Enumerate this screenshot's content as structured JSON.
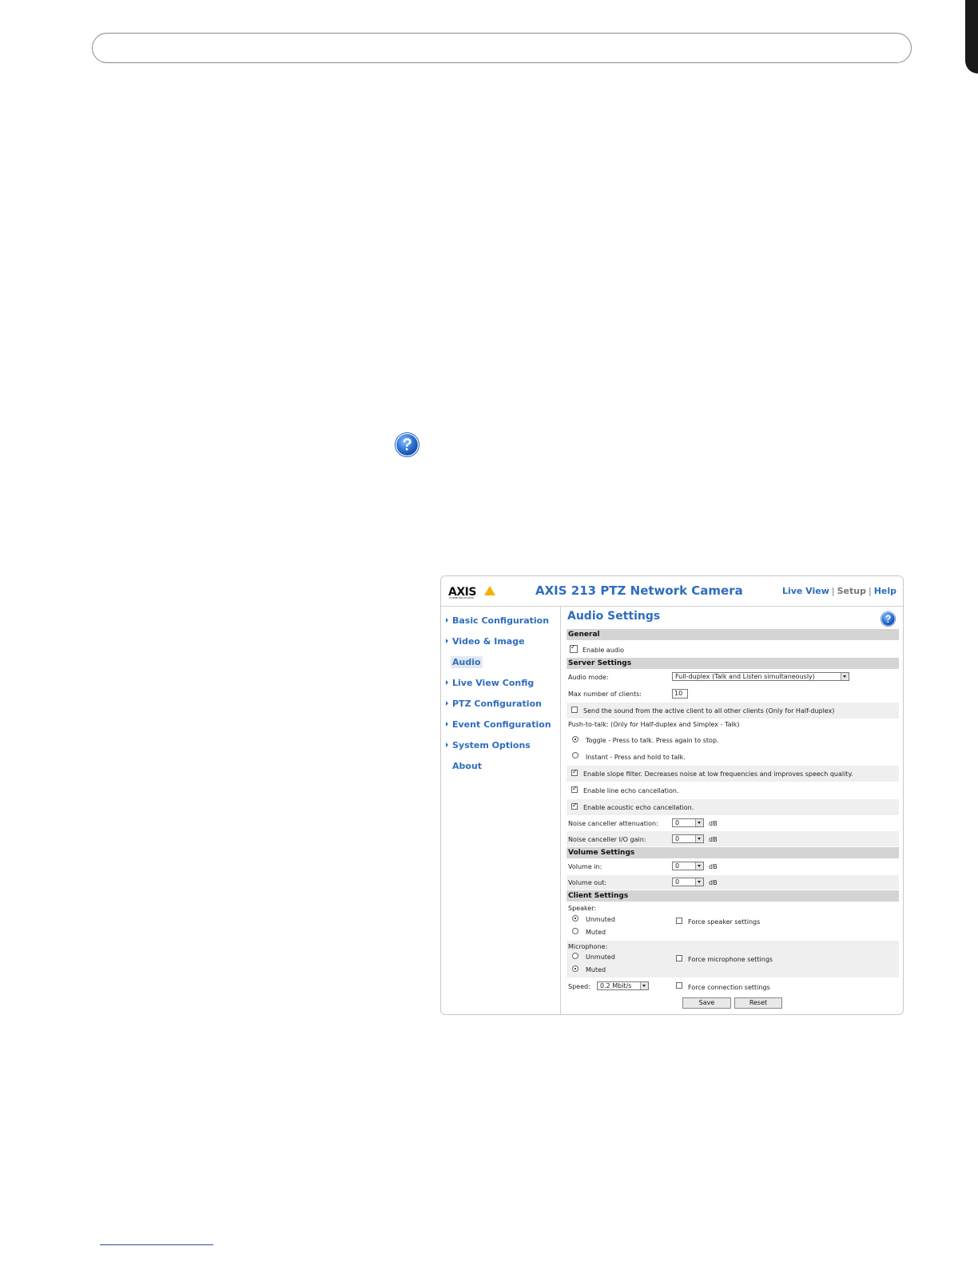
{
  "app": {
    "logo_text": "AXIS",
    "logo_sub": "COMMUNICATIONS",
    "title": "AXIS 213 PTZ Network Camera",
    "links": [
      "Live View",
      "Setup",
      "Help"
    ],
    "link_separator": "|"
  },
  "sidebar": {
    "items": [
      {
        "label": "Basic Configuration"
      },
      {
        "label": "Video & Image"
      },
      {
        "label": "Audio"
      },
      {
        "label": "Live View Config"
      },
      {
        "label": "PTZ Configuration"
      },
      {
        "label": "Event Configuration"
      },
      {
        "label": "System Options"
      },
      {
        "label": "About"
      }
    ],
    "active": "Audio"
  },
  "main": {
    "title": "Audio Settings",
    "general": {
      "header": "General",
      "enable_audio_label": "Enable audio",
      "enable_audio": true
    },
    "server": {
      "header": "Server Settings",
      "audio_mode_label": "Audio mode:",
      "audio_mode_value": "Full-duplex (Talk and Listen simultaneously)",
      "max_clients_label": "Max number of clients:",
      "max_clients_value": "10",
      "send_sound_label": "Send the sound from the active client to all other clients (Only for Half-duplex)",
      "send_sound": false,
      "ptt_label": "Push-to-talk: (Only for Half-duplex and Simplex - Talk)",
      "toggle_label": "Toggle - Press to talk. Press again to stop.",
      "instant_label": "Instant - Press and hold to talk.",
      "ptt_selected": "Toggle",
      "slope_label": "Enable slope filter. Decreases noise at low frequencies and improves speech quality.",
      "slope": true,
      "line_echo_label": "Enable line echo cancellation.",
      "line_echo": true,
      "acoustic_echo_label": "Enable acoustic echo cancellation.",
      "acoustic_echo": true,
      "noise_att_label": "Noise canceller attenuation:",
      "noise_att_value": "0",
      "noise_gain_label": "Noise canceller I/O gain:",
      "noise_gain_value": "0",
      "unit_db": "dB"
    },
    "volume": {
      "header": "Volume Settings",
      "in_label": "Volume in:",
      "in_value": "0",
      "out_label": "Volume out:",
      "out_value": "0"
    },
    "client": {
      "header": "Client Settings",
      "speaker_label": "Speaker:",
      "unmuted_label": "Unmuted",
      "muted_label": "Muted",
      "speaker_selected": "Unmuted",
      "force_speaker_label": "Force speaker settings",
      "microphone_label": "Microphone:",
      "microphone_selected": "Muted",
      "force_mic_label": "Force microphone settings",
      "speed_label": "Speed:",
      "speed_value": "0.2 Mbit/s",
      "force_conn_label": "Force connection settings"
    },
    "buttons": {
      "save": "Save",
      "reset": "Reset"
    }
  }
}
